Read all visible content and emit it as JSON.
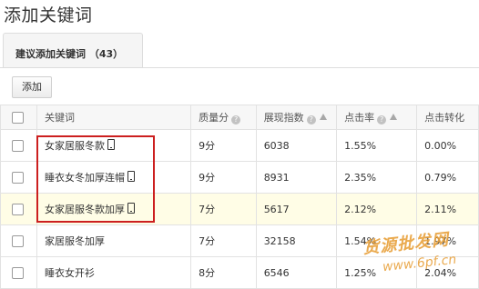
{
  "page": {
    "title": "添加关键词"
  },
  "tabs": [
    {
      "label": "建议添加关键词 （43）"
    }
  ],
  "toolbar": {
    "add_label": "添加"
  },
  "table": {
    "headers": {
      "keyword": "关键词",
      "quality": "质量分",
      "index": "展现指数",
      "ctr": "点击率",
      "conv": "点击转化"
    },
    "rows": [
      {
        "keyword": "女家居服冬款",
        "mobile": true,
        "quality": "9分",
        "index": "6038",
        "ctr": "1.55%",
        "conv": "0.00%",
        "highlighted": false
      },
      {
        "keyword": "睡衣女冬加厚连帽",
        "mobile": true,
        "quality": "9分",
        "index": "8931",
        "ctr": "2.35%",
        "conv": "0.79%",
        "highlighted": false
      },
      {
        "keyword": "女家居服冬款加厚",
        "mobile": true,
        "quality": "7分",
        "index": "5617",
        "ctr": "2.12%",
        "conv": "2.11%",
        "highlighted": true
      },
      {
        "keyword": "家居服冬加厚",
        "mobile": false,
        "quality": "7分",
        "index": "32158",
        "ctr": "1.54%",
        "conv": "1.97%",
        "highlighted": false
      },
      {
        "keyword": "睡衣女开衫",
        "mobile": false,
        "quality": "8分",
        "index": "6546",
        "ctr": "1.25%",
        "conv": "2.04%",
        "highlighted": false
      }
    ]
  },
  "watermark": {
    "text": "货源批发网",
    "url": "www.6pf.cn"
  },
  "colors": {
    "highlight_border": "#cc1f1f",
    "highlight_row": "#fffde6",
    "watermark": "#e8a13c"
  }
}
